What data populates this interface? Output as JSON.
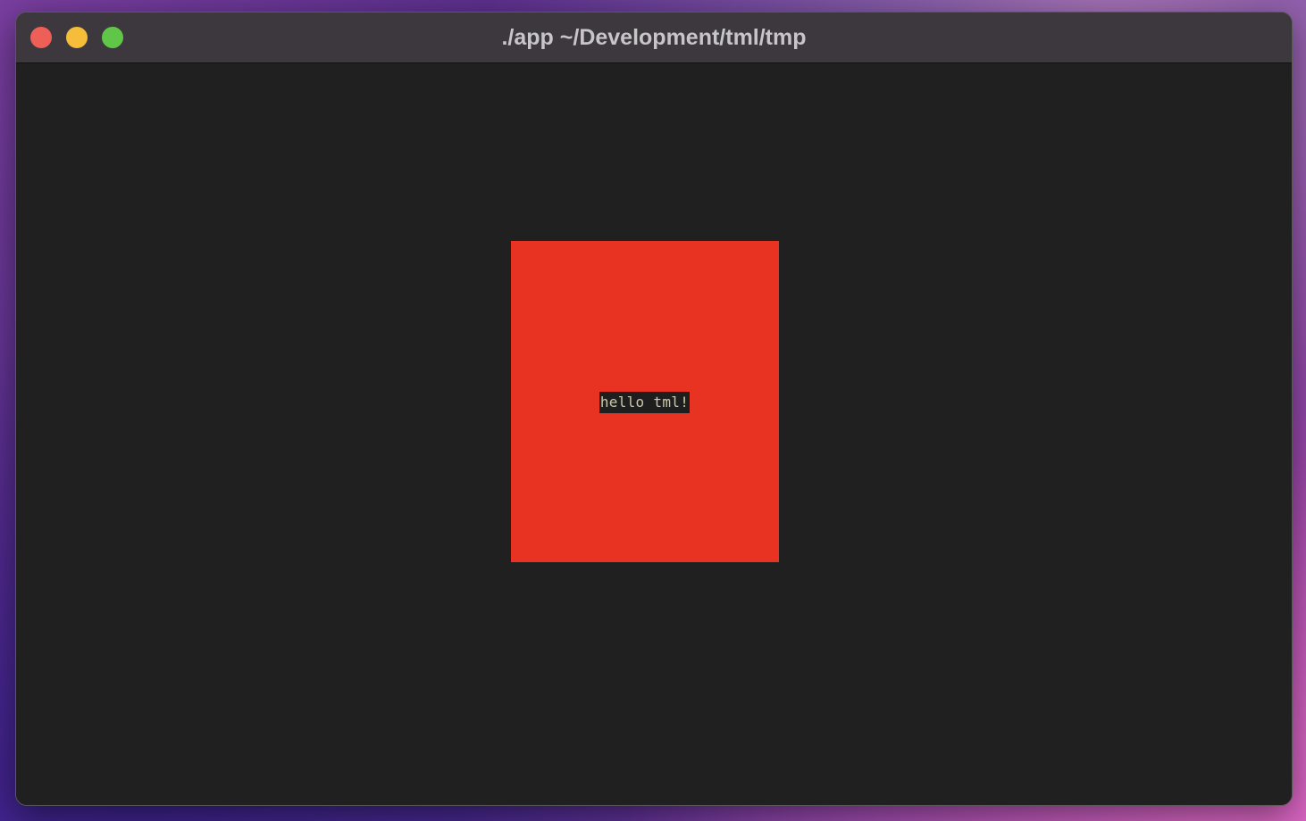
{
  "window": {
    "title": "./app ~/Development/tml/tmp"
  },
  "terminal": {
    "text": "hello tml!",
    "box_color": "#e83323",
    "background_color": "#202020"
  }
}
